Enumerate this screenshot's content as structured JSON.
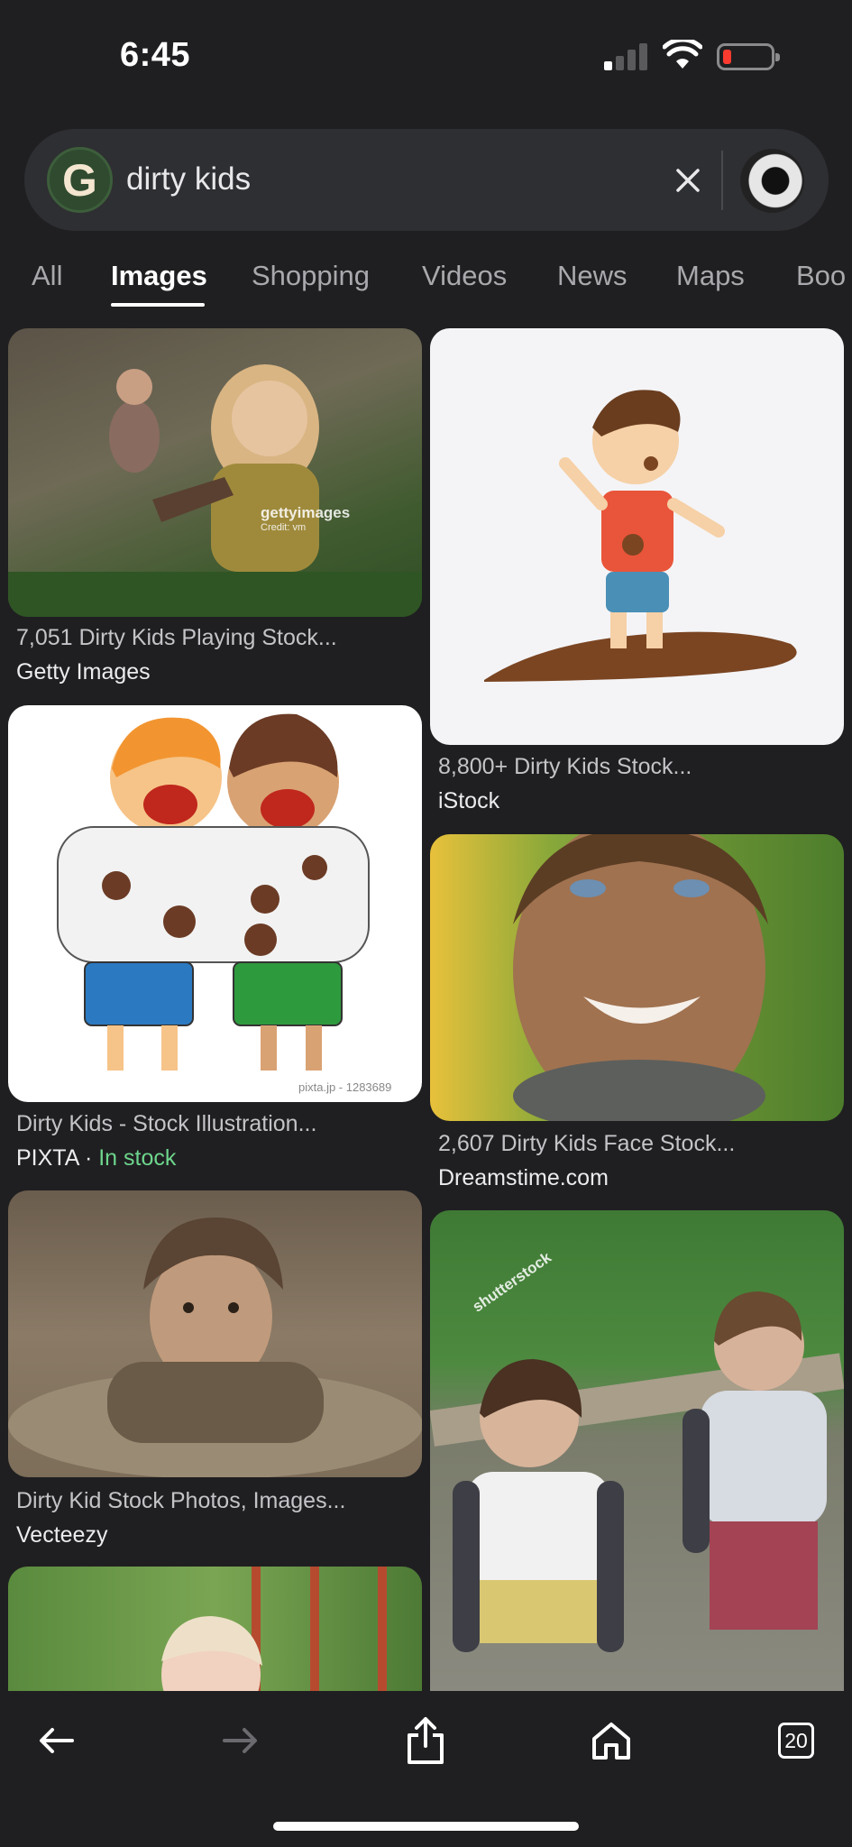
{
  "status_bar": {
    "time": "6:45"
  },
  "search": {
    "query": "dirty kids",
    "clear_icon": "close-icon",
    "account_icon": "avatar"
  },
  "tabs": [
    {
      "label": "All"
    },
    {
      "label": "Images",
      "active": true
    },
    {
      "label": "Shopping"
    },
    {
      "label": "Videos"
    },
    {
      "label": "News"
    },
    {
      "label": "Maps"
    },
    {
      "label": "Boo"
    }
  ],
  "results": [
    {
      "title": "7,051 Dirty Kids Playing Stock...",
      "source": "Getty Images",
      "image_alt": "two children playing in mud",
      "watermark": "gettyimages",
      "watermark_credit": "Credit: vm"
    },
    {
      "title": "8,800+ Dirty Kids Stock...",
      "source": "iStock",
      "image_alt": "cartoon boy standing in mud puddle"
    },
    {
      "title": "Dirty Kids - Stock Illustration...",
      "source": "PIXTA",
      "source_separator": " · ",
      "stock_status": "In stock",
      "image_alt": "two cartoon kids with mud stains",
      "watermark": "pixta.jp - 1283689"
    },
    {
      "title": "2,607 Dirty Kids Face Stock...",
      "source": "Dreamstime.com",
      "image_alt": "muddy smiling child face"
    },
    {
      "title": "Dirty Kid Stock Photos, Images...",
      "source": "Vecteezy",
      "image_alt": "child crawling in mud"
    },
    {
      "title": "",
      "source": "",
      "image_alt": "two kids covered in mud outdoors",
      "watermark": "shutterstock"
    },
    {
      "title": "",
      "source": "",
      "image_alt": "toddler in garden"
    }
  ],
  "toolbar": {
    "back_icon": "back-arrow-icon",
    "forward_icon": "forward-arrow-icon",
    "share_icon": "share-icon",
    "home_icon": "home-icon",
    "tab_count": "20"
  },
  "colors": {
    "background": "#1f1f21",
    "search_bar": "#2e2f32",
    "in_stock": "#6dd58c"
  }
}
